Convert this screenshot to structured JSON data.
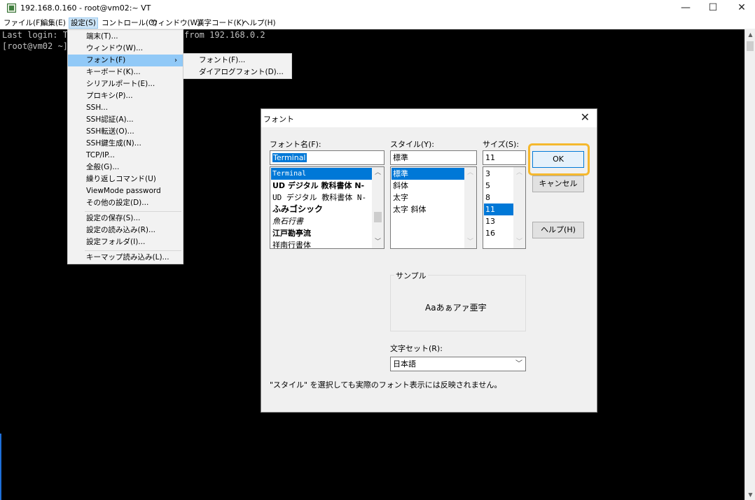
{
  "window": {
    "title": "192.168.0.160 - root@vm02:~ VT"
  },
  "menubar": [
    "ファイル(F)",
    "編集(E)",
    "設定(S)",
    "コントロール(O)",
    "ウィンドウ(W)",
    "漢字コード(K)",
    "ヘルプ(H)"
  ],
  "terminal": {
    "line1": "Last login: Tu",
    "line1b": "from 192.168.0.2",
    "line2": "[root@vm02 ~]"
  },
  "settings_menu": {
    "items": [
      "端末(T)...",
      "ウィンドウ(W)...",
      "フォント(F)",
      "キーボード(K)...",
      "シリアルポート(E)...",
      "プロキシ(P)...",
      "SSH...",
      "SSH認証(A)...",
      "SSH転送(O)...",
      "SSH鍵生成(N)...",
      "TCP/IP...",
      "全般(G)...",
      "繰り返しコマンド(U)",
      "ViewMode password",
      "その他の設定(D)...",
      "設定の保存(S)...",
      "設定の読み込み(R)...",
      "設定フォルダ(I)...",
      "キーマップ読み込み(L)..."
    ],
    "highlighted": "フォント(F)",
    "submenu_arrow": "›"
  },
  "font_submenu": {
    "items": [
      "フォント(F)...",
      "ダイアログフォント(D)..."
    ]
  },
  "dialog": {
    "title": "フォント",
    "close": "✕",
    "font_name_label": "フォント名(F):",
    "font_name_value": "Terminal",
    "font_list": [
      "Terminal",
      "UD デジタル 教科書体 N-",
      "UD デジタル 教科書体 N-",
      "ふみゴシック",
      "魚石行書",
      "江戸勘亭流",
      "祥南行書体"
    ],
    "style_label": "スタイル(Y):",
    "style_value": "標準",
    "style_list": [
      "標準",
      "斜体",
      "太字",
      "太字 斜体"
    ],
    "size_label": "サイズ(S):",
    "size_value": "11",
    "size_list": [
      "3",
      "5",
      "8",
      "11",
      "13",
      "16"
    ],
    "ok_label": "OK",
    "cancel_label": "キャンセル",
    "help_label": "ヘルプ(H)",
    "sample_label": "サンプル",
    "sample_text": "Aaあぁアァ亜宇",
    "charset_label": "文字セット(R):",
    "charset_value": "日本語",
    "note": "\"スタイル\" を選択しても実際のフォント表示には反映されません。"
  },
  "colors": {
    "accent": "#0078d7",
    "highlight_ring": "#f5b82e",
    "menu_highlight": "#91c9f7"
  }
}
